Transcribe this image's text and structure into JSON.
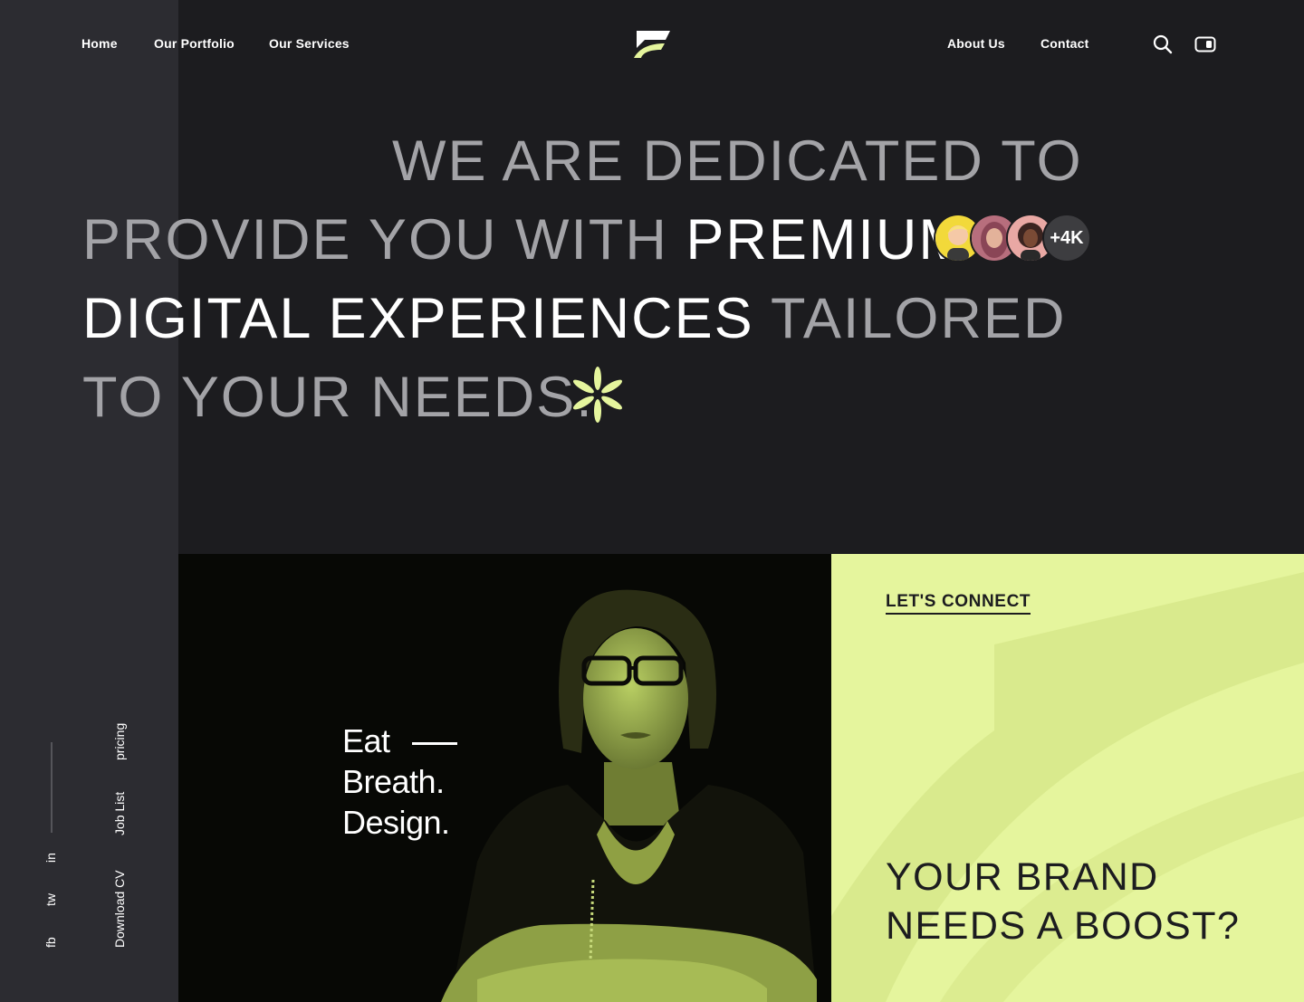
{
  "nav": {
    "home": "Home",
    "portfolio": "Our Portfolio",
    "services": "Our Services",
    "about": "About Us",
    "contact": "Contact"
  },
  "header": {
    "logo_icon": "f-swoosh-logo",
    "search_icon": "search-icon",
    "toggle_icon": "toggle-icon"
  },
  "hero": {
    "line1": "WE ARE DEDICATED TO",
    "line2_gray": "PROVIDE YOU WITH ",
    "line2_white": "PREMIUM",
    "line3_white": "DIGITAL EXPERIENCES",
    "line3_gray": " TAILORED",
    "line4": "TO YOUR NEEDS.",
    "avatar_count": "+4K"
  },
  "photo_panel": {
    "tagline_1": "Eat",
    "tagline_2": "Breath.",
    "tagline_3": "Design."
  },
  "cta_panel": {
    "link": "LET'S CONNECT",
    "title_1": "YOUR BRAND",
    "title_2": "NEEDS A BOOST?"
  },
  "sidebar": {
    "links": [
      "pricing",
      "Job List",
      "Download CV"
    ],
    "social": [
      "in",
      "tw",
      "fb"
    ]
  },
  "colors": {
    "background": "#1c1c1f",
    "sidebar": "#2c2c31",
    "accent": "#e5f59d",
    "photo_tint": "#c8dd6e"
  }
}
